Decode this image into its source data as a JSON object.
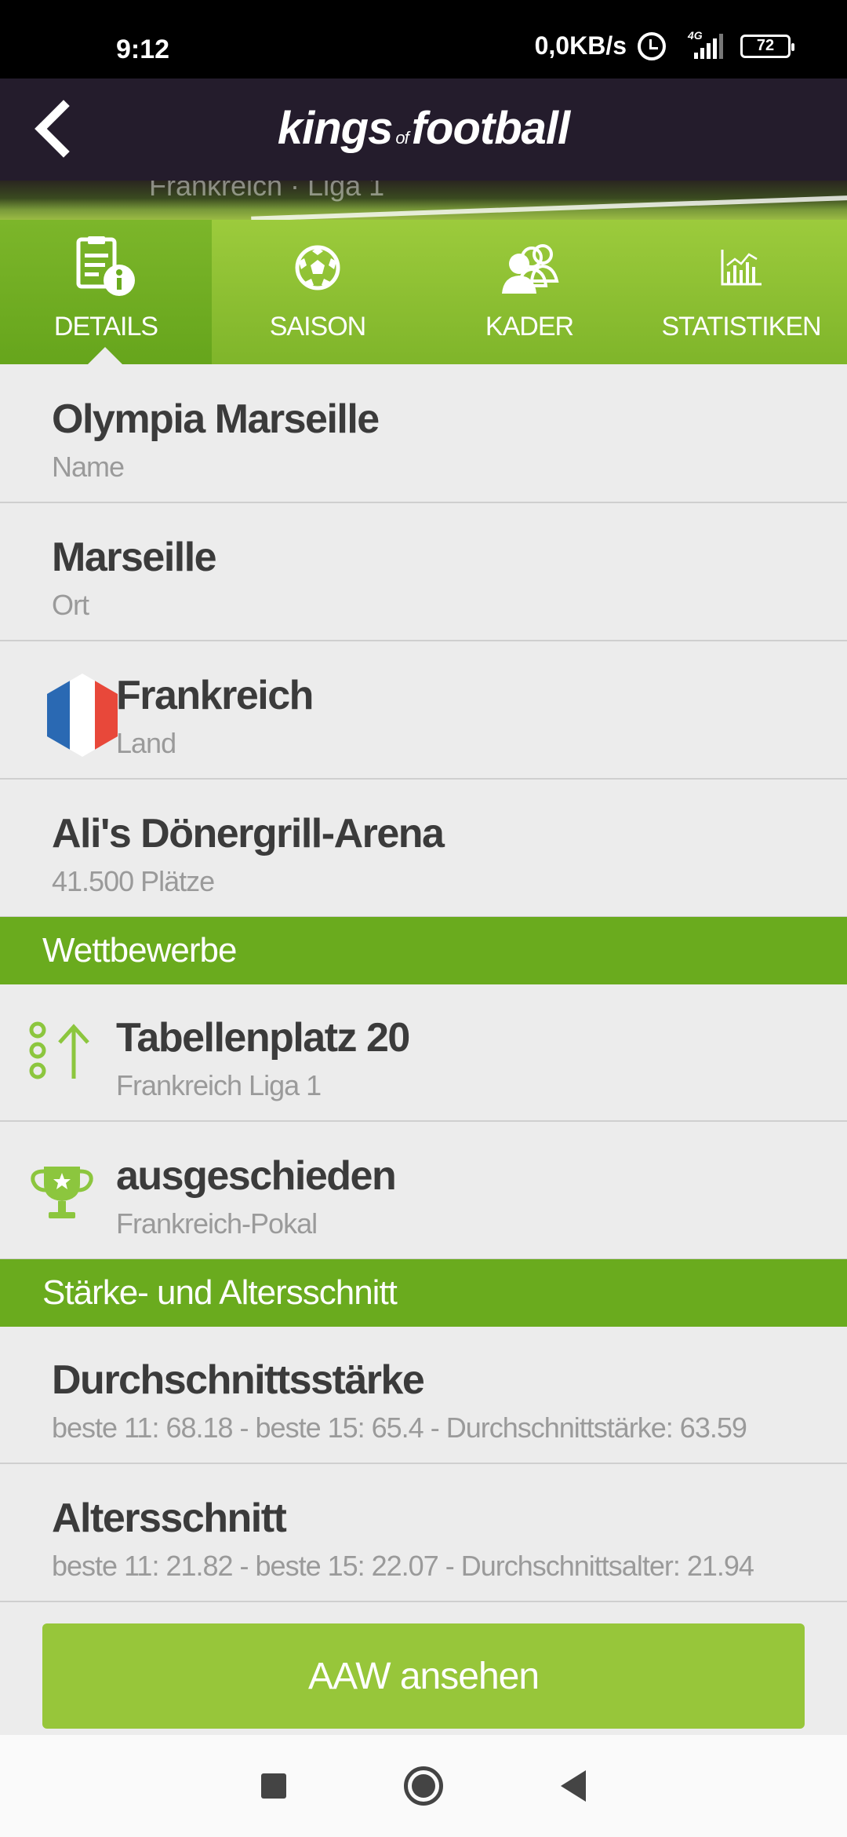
{
  "status_bar": {
    "time": "9:12",
    "net_speed": "0,0KB/s",
    "network_type": "4G",
    "battery": "72"
  },
  "app": {
    "logo_kings": "kings",
    "logo_of": "of",
    "logo_football": "football"
  },
  "hero": {
    "text": "Frankreich · Liga 1"
  },
  "tabs": [
    {
      "label": "DETAILS",
      "icon": "document-info-icon",
      "active": true
    },
    {
      "label": "SAISON",
      "icon": "soccer-ball-icon",
      "active": false
    },
    {
      "label": "KADER",
      "icon": "team-icon",
      "active": false
    },
    {
      "label": "STATISTIKEN",
      "icon": "bar-chart-icon",
      "active": false
    }
  ],
  "details": {
    "name": {
      "title": "Olympia Marseille",
      "sub": "Name"
    },
    "city": {
      "title": "Marseille",
      "sub": "Ort"
    },
    "country": {
      "title": "Frankreich",
      "sub": "Land"
    },
    "stadium": {
      "title": "Ali's Dönergrill-Arena",
      "sub": "41.500 Plätze"
    }
  },
  "competitions": {
    "header": "Wettbewerbe",
    "league": {
      "title": "Tabellenplatz 20",
      "sub": "Frankreich Liga 1"
    },
    "cup": {
      "title": "ausgeschieden",
      "sub": "Frankreich-Pokal"
    }
  },
  "strength": {
    "header": "Stärke- und Altersschnitt",
    "avg_strength": {
      "title": "Durchschnittsstärke",
      "sub": "beste 11: 68.18 - beste 15: 65.4 - Durchschnittstärke: 63.59"
    },
    "avg_age": {
      "title": "Altersschnitt",
      "sub": "beste 11: 21.82 - beste 15: 22.07 - Durchschnittsalter: 21.94"
    }
  },
  "cta": {
    "label": "AAW ansehen"
  },
  "colors": {
    "accent_green": "#6aab1e",
    "light_green": "#97c63a",
    "header_dark": "#241c2c"
  }
}
